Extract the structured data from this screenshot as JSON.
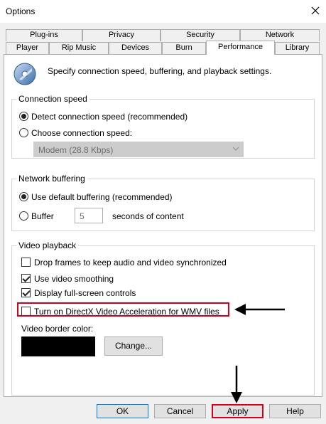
{
  "window": {
    "title": "Options",
    "close_glyph": "✕"
  },
  "tabs": {
    "row1": [
      "Plug-ins",
      "Privacy",
      "Security",
      "Network"
    ],
    "row2": [
      "Player",
      "Rip Music",
      "Devices",
      "Burn",
      "Performance",
      "Library"
    ],
    "active": "Performance"
  },
  "intro": "Specify connection speed, buffering, and playback settings.",
  "connection_speed": {
    "title": "Connection speed",
    "detect_label": "Detect connection speed (recommended)",
    "choose_label": "Choose connection speed:",
    "selected": "detect",
    "speed_value": "Modem (28.8 Kbps)"
  },
  "network_buffering": {
    "title": "Network buffering",
    "default_label": "Use default buffering (recommended)",
    "buffer_label": "Buffer",
    "buffer_value": "5",
    "seconds_label": "seconds of content",
    "selected": "default"
  },
  "video_playback": {
    "title": "Video playback",
    "drop_frames_label": "Drop frames to keep audio and video synchronized",
    "drop_frames_checked": false,
    "smoothing_label": "Use video smoothing",
    "smoothing_checked": true,
    "fullscreen_label": "Display full-screen controls",
    "fullscreen_checked": true,
    "directx_label": "Turn on DirectX Video Acceleration for WMV files",
    "directx_checked": false,
    "border_color_label": "Video border color:",
    "border_color": "#000000",
    "change_label": "Change..."
  },
  "buttons": {
    "ok": "OK",
    "cancel": "Cancel",
    "apply": "Apply",
    "help": "Help"
  },
  "colors": {
    "highlight": "#d0021b",
    "annotation_arrow": "#000000",
    "disabled_fill": "#cccccc",
    "default_button_border": "#0078d7"
  },
  "icons": {
    "app": "media-player-disc-icon",
    "close": "close-icon"
  }
}
